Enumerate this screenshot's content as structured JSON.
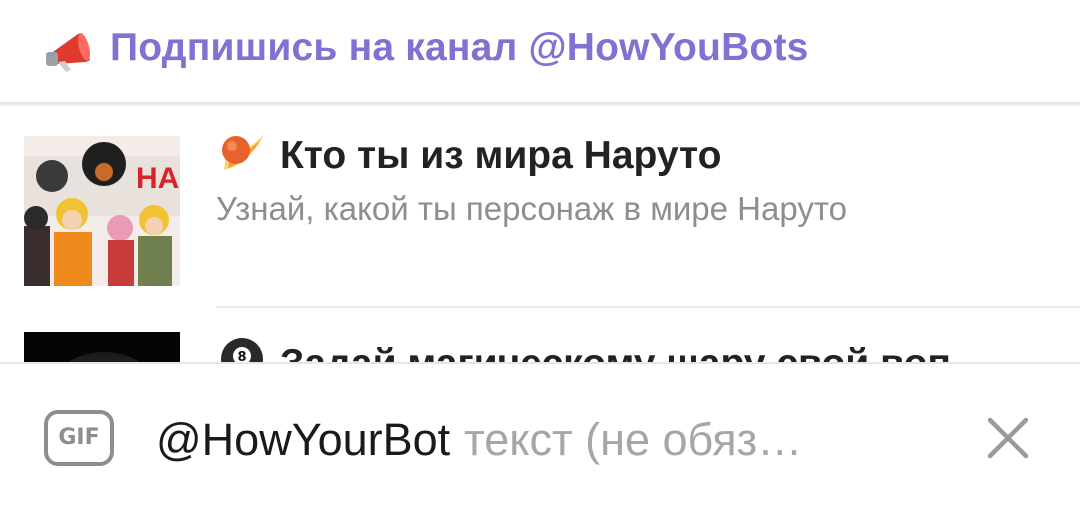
{
  "banner": {
    "icon": "megaphone-icon",
    "text": "Подпишись на канал @HowYouBots",
    "color": "#7e72d2"
  },
  "results": [
    {
      "icon": "fireball-icon",
      "title": "Кто ты из мира Наруто",
      "description": "Узнай, какой ты персонаж в мире Наруто"
    },
    {
      "icon": "eight-ball-icon",
      "title": "Задай магическому шару свой воп",
      "description": ""
    }
  ],
  "input": {
    "gif_label": "GIF",
    "value": "@HowYourBot",
    "placeholder": "текст (не обяз…"
  },
  "close_icon": "close-icon"
}
